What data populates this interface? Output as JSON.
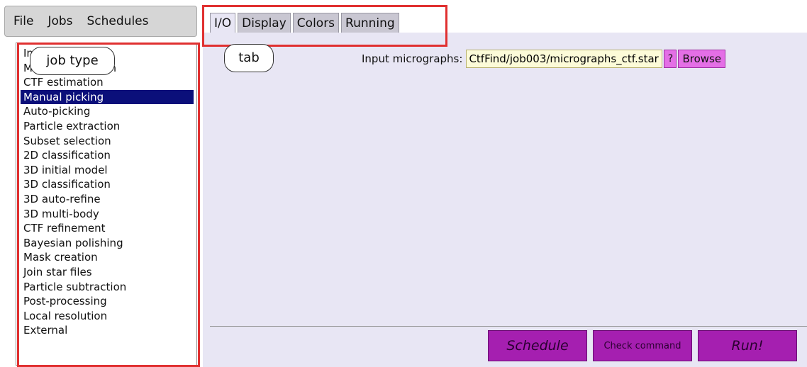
{
  "menubar": {
    "items": [
      "File",
      "Jobs",
      "Schedules"
    ]
  },
  "tabs": [
    {
      "label": "I/O"
    },
    {
      "label": "Display"
    },
    {
      "label": "Colors"
    },
    {
      "label": "Running"
    }
  ],
  "job_list": {
    "selected": "Manual picking",
    "items": [
      "Import",
      "Motion correction",
      "CTF estimation",
      "Manual picking",
      "Auto-picking",
      "Particle extraction",
      "Subset selection",
      "2D classification",
      "3D initial model",
      "3D classification",
      "3D auto-refine",
      "3D multi-body",
      "CTF refinement",
      "Bayesian polishing",
      "Mask creation",
      "Join star files",
      "Particle subtraction",
      "Post-processing",
      "Local resolution",
      "External"
    ]
  },
  "io": {
    "label": "Input micrographs:",
    "value": "CtfFind/job003/micrographs_ctf.star",
    "help_label": "?",
    "browse_label": "Browse"
  },
  "actions": {
    "schedule_label": "Schedule",
    "check_label": "Check command",
    "run_label": "Run!"
  },
  "annotations": {
    "job_type_label": "job type",
    "tab_label": "tab"
  },
  "colors": {
    "selection": "#0b0f7a",
    "panel_bg": "#e8e6f4",
    "input_bg": "#fcfbd8",
    "button_accent": "#a51fb0",
    "small_button_accent": "#e46fe6",
    "annotation": "#e03030"
  }
}
